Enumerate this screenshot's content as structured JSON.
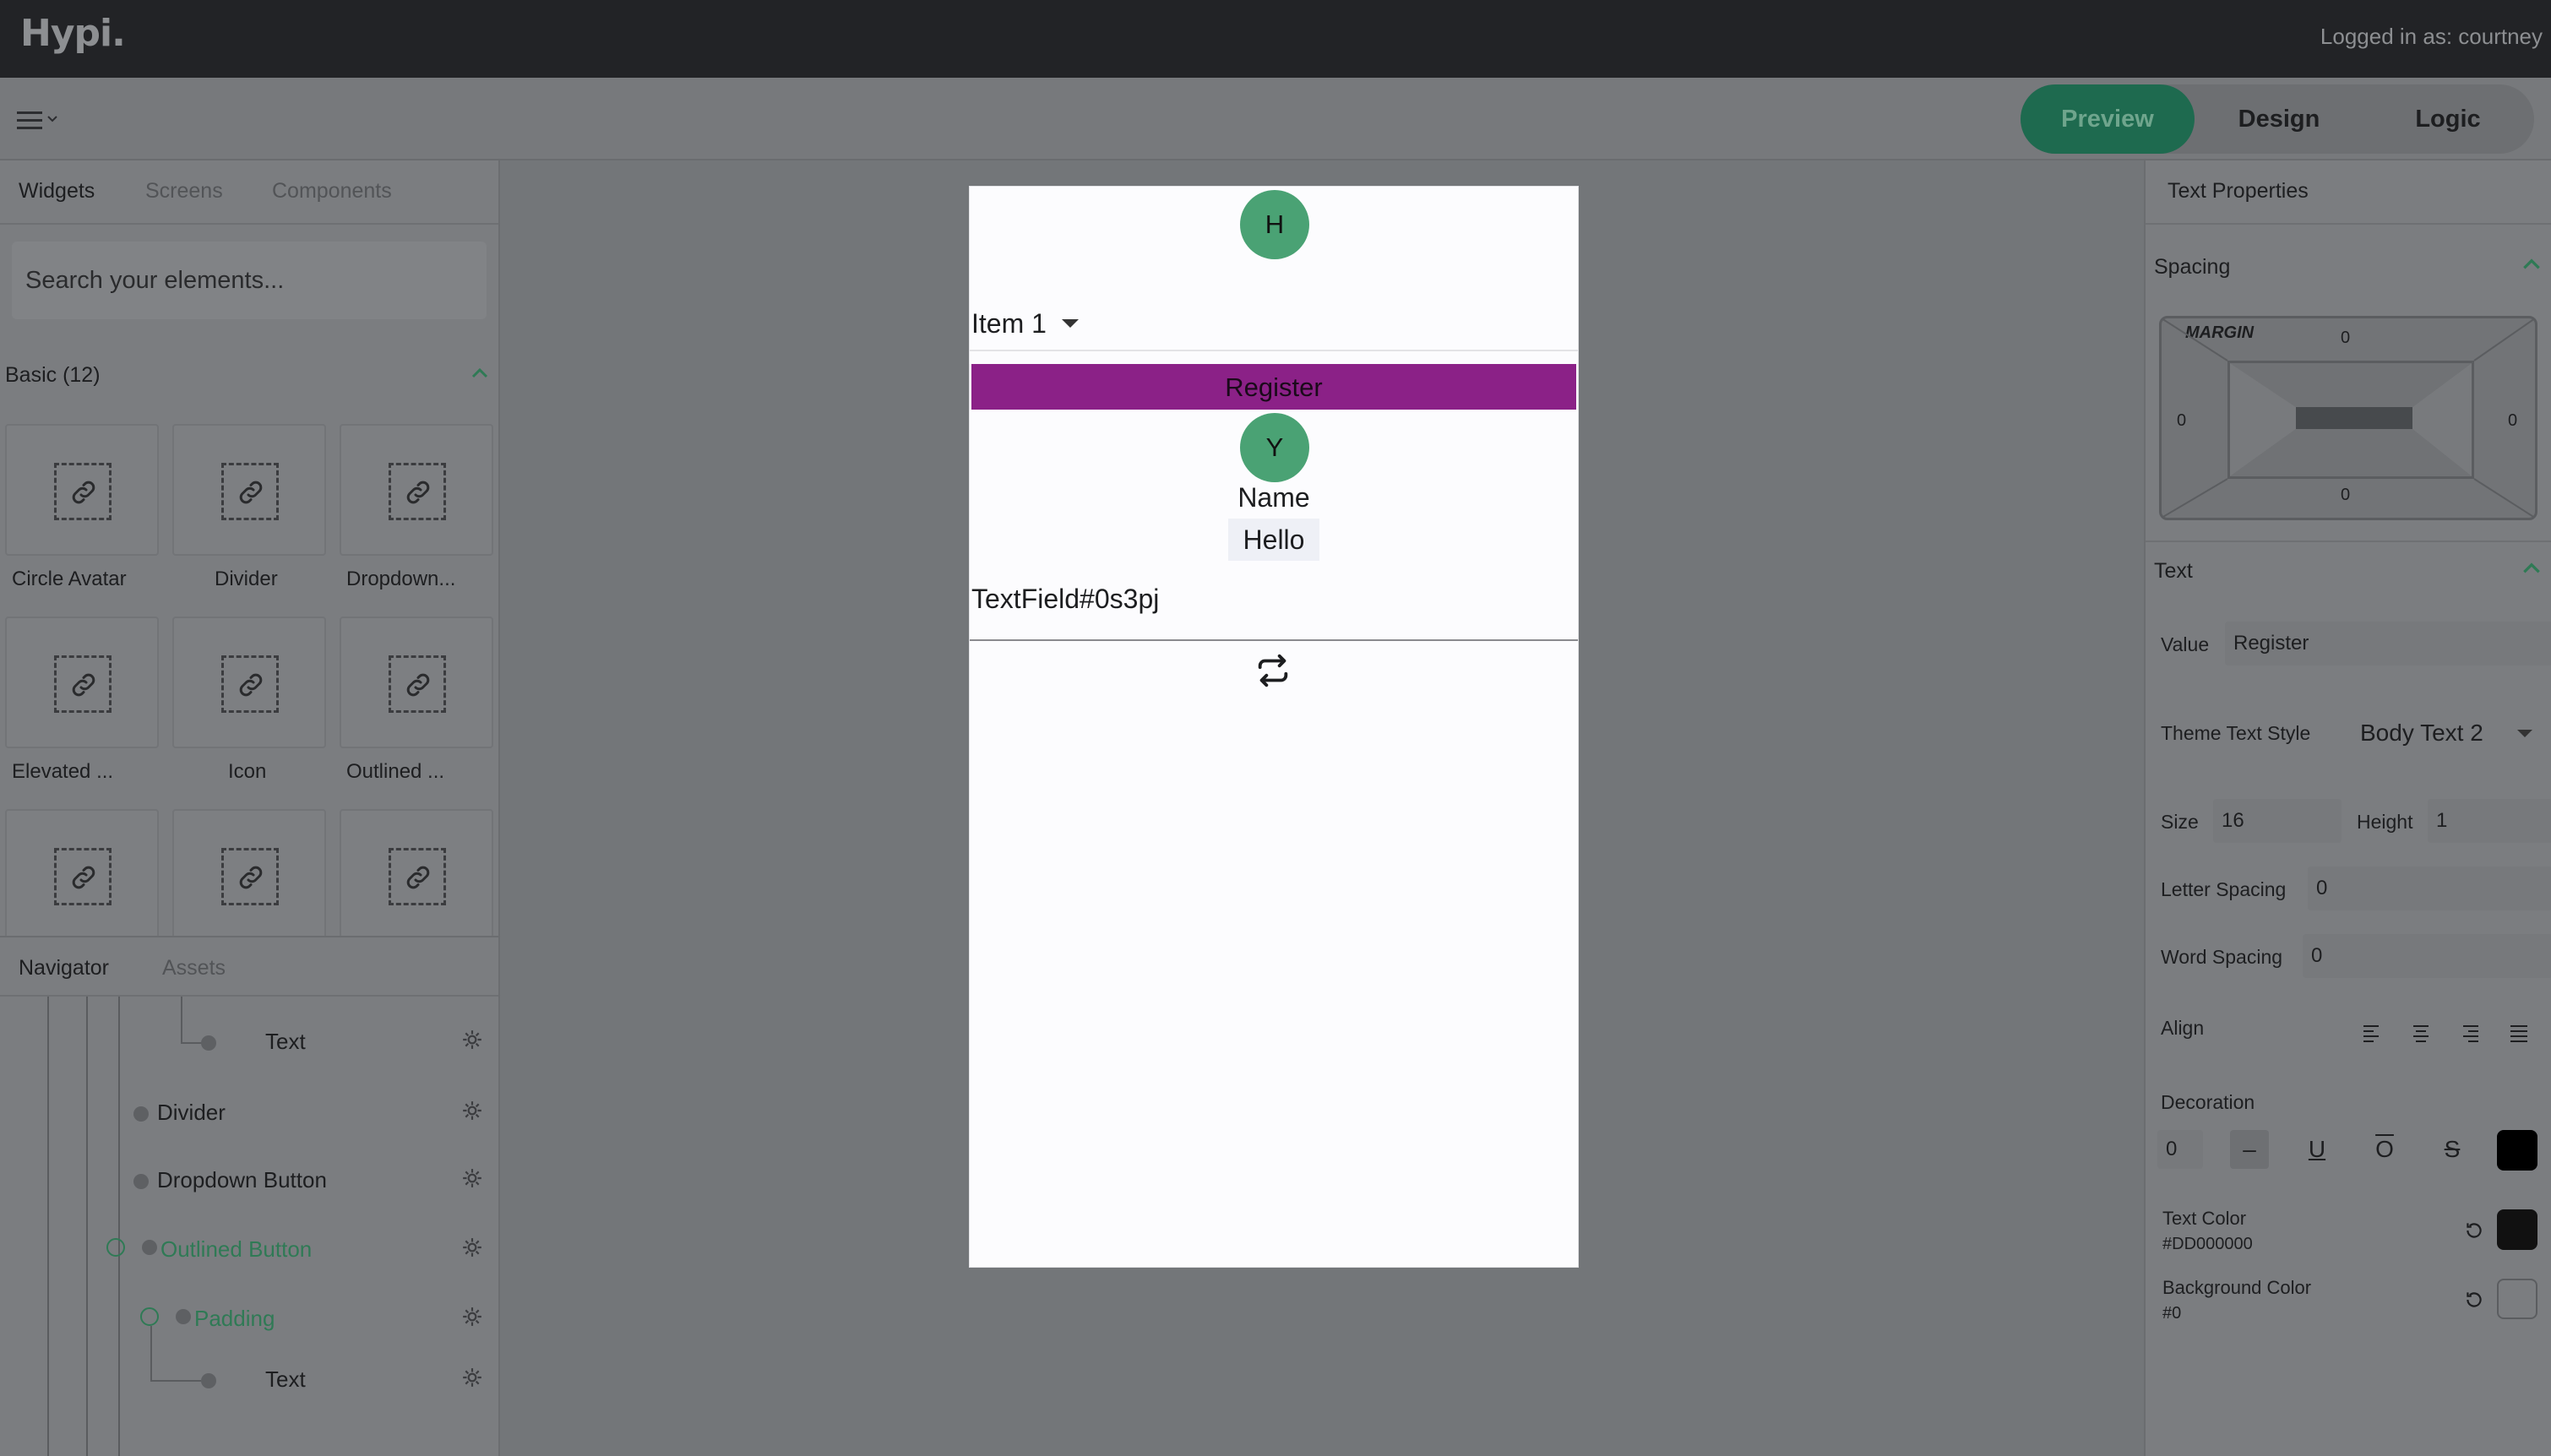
{
  "app": {
    "logo": "Hypi.",
    "login_text": "Logged in as: courtney"
  },
  "modes": [
    {
      "label": "Preview",
      "active": true
    },
    {
      "label": "Design",
      "active": false
    },
    {
      "label": "Logic",
      "active": false
    }
  ],
  "left_panel": {
    "tabs": [
      "Widgets",
      "Screens",
      "Components"
    ],
    "search_placeholder": "Search your elements...",
    "section_title": "Basic (12)",
    "widgets": [
      {
        "label": "Circle Avatar",
        "icon": "link-icon"
      },
      {
        "label": "Divider",
        "icon": "link-icon"
      },
      {
        "label": "Dropdown...",
        "icon": "link-icon"
      },
      {
        "label": "Elevated ...",
        "icon": "link-icon"
      },
      {
        "label": "Icon",
        "icon": "link-icon"
      },
      {
        "label": "Outlined ...",
        "icon": "link-icon"
      },
      {
        "label": "",
        "icon": "link-icon"
      },
      {
        "label": "",
        "icon": "link-icon"
      },
      {
        "label": "",
        "icon": "link-icon"
      }
    ]
  },
  "navigator": {
    "tabs": [
      "Navigator",
      "Assets"
    ],
    "nodes": [
      {
        "label": "Text",
        "selected": false
      },
      {
        "label": "Divider",
        "selected": false
      },
      {
        "label": "Dropdown Button",
        "selected": false
      },
      {
        "label": "Outlined Button",
        "selected": true
      },
      {
        "label": "Padding",
        "selected": true
      },
      {
        "label": "Text",
        "selected": false
      }
    ]
  },
  "device": {
    "avatar_top": "H",
    "dropdown_value": "Item 1",
    "register_label": "Register",
    "avatar_bottom": "Y",
    "name_text": "Name",
    "hello_text": "Hello",
    "textfield_text": "TextField#0s3pj",
    "register_color": "#8b2187",
    "avatar_color": "#4aa274"
  },
  "right_panel": {
    "title": "Text Properties",
    "spacing": {
      "section": "Spacing",
      "margin_label": "MARGIN",
      "margin_top": "0",
      "margin_left": "0",
      "margin_right": "0",
      "margin_bottom": "0"
    },
    "text": {
      "section": "Text",
      "value_label": "Value",
      "value": "Register",
      "theme_style_label": "Theme Text Style",
      "theme_style_value": "Body Text 2",
      "size_label": "Size",
      "size_value": "16",
      "height_label": "Height",
      "height_value": "1",
      "letter_spacing_label": "Letter Spacing",
      "letter_spacing_value": "0",
      "word_spacing_label": "Word Spacing",
      "word_spacing_value": "0",
      "align_label": "Align",
      "decoration_label": "Decoration",
      "decoration_value": "0",
      "text_color_label": "Text Color",
      "text_color_value": "#DD000000",
      "bg_color_label": "Background Color",
      "bg_color_value": "#0"
    }
  }
}
